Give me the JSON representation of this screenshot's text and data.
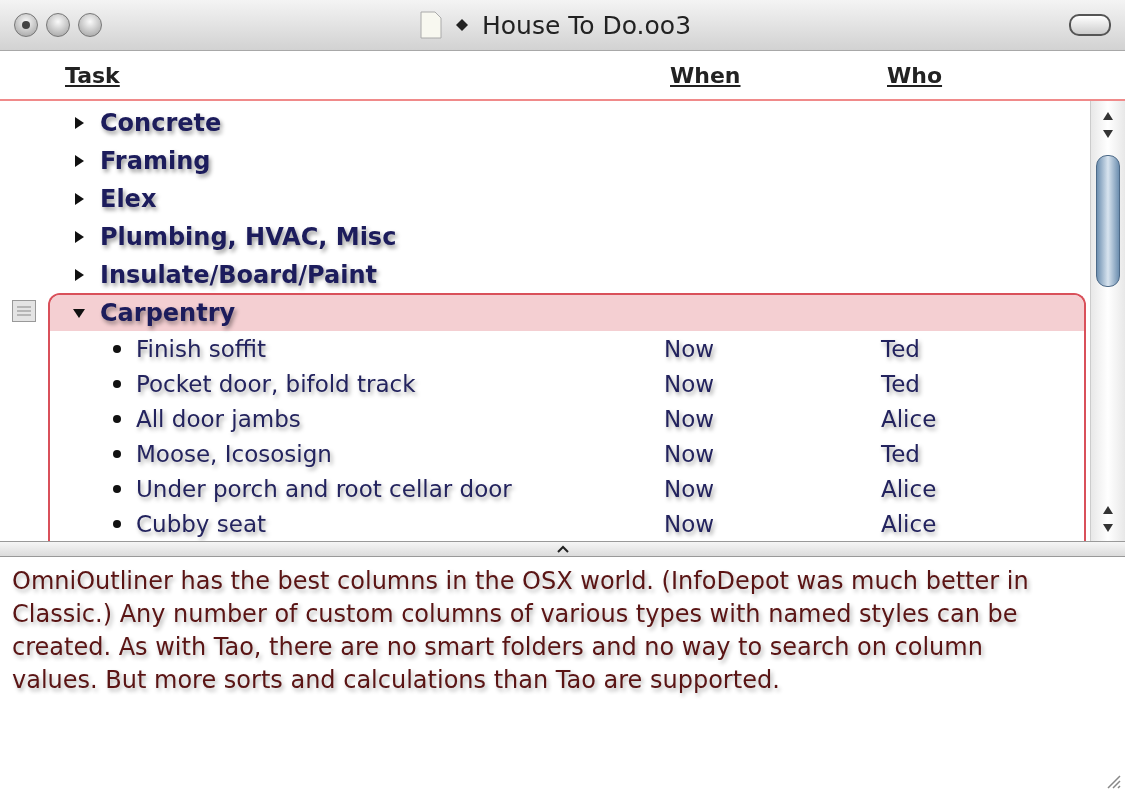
{
  "window": {
    "title": "House To Do.oo3",
    "edited": true
  },
  "columns": [
    "Task",
    "When",
    "Who"
  ],
  "rows": [
    {
      "title": "Concrete",
      "expanded": false,
      "selected": false
    },
    {
      "title": "Framing",
      "expanded": false,
      "selected": false
    },
    {
      "title": "Elex",
      "expanded": false,
      "selected": false
    },
    {
      "title": "Plumbing, HVAC, Misc",
      "expanded": false,
      "selected": false
    },
    {
      "title": "Insulate/Board/Paint",
      "expanded": false,
      "selected": false
    },
    {
      "title": "Carpentry",
      "expanded": true,
      "selected": true,
      "children": [
        {
          "title": "Finish soffit",
          "when": "Now",
          "who": "Ted"
        },
        {
          "title": "Pocket door, bifold track",
          "when": "Now",
          "who": "Ted"
        },
        {
          "title": "All door jambs",
          "when": "Now",
          "who": "Alice"
        },
        {
          "title": "Moose, Icososign",
          "when": "Now",
          "who": "Ted"
        },
        {
          "title": "Under porch and root cellar door",
          "when": "Now",
          "who": "Alice"
        },
        {
          "title": "Cubby seat",
          "when": "Now",
          "who": "Alice"
        }
      ]
    }
  ],
  "notes": "OmniOutliner has the best columns in the OSX world. (InfoDepot was much better in Classic.) Any number of custom columns of various types with named styles can be created. As with Tao, there are no smart folders and no way to search on column values. But more sorts and calculations than Tao are supported."
}
